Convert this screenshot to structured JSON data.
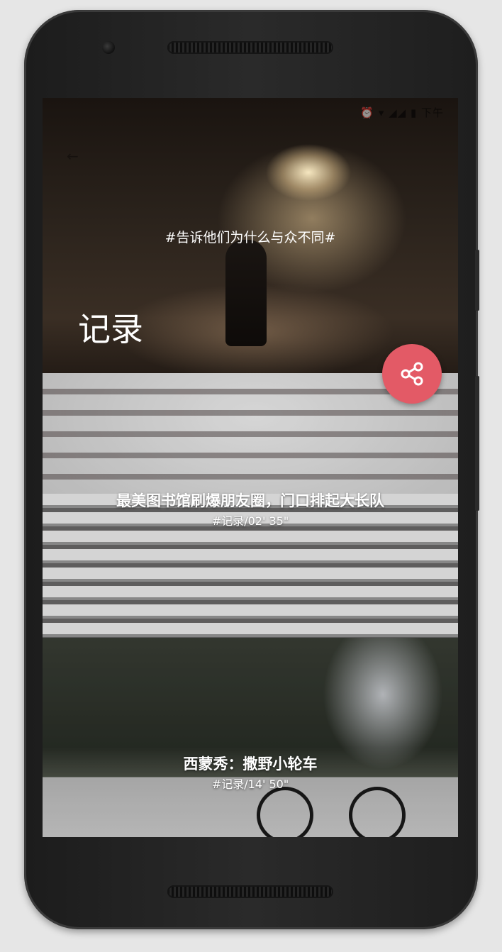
{
  "statusbar": {
    "text": "⏰ ▾ ◢◢ ▮ 下午"
  },
  "header": {
    "slogan": "#告诉他们为什么与众不同#",
    "title": "记录",
    "share_icon": "share-icon",
    "fab_color": "#e35a66"
  },
  "cards": [
    {
      "title": "最美图书馆刷爆朋友圈，门口排起大长队",
      "meta": "#记录/02' 35\""
    },
    {
      "title": "西蒙秀：撒野小轮车",
      "meta": "#记录/14' 50\""
    }
  ]
}
